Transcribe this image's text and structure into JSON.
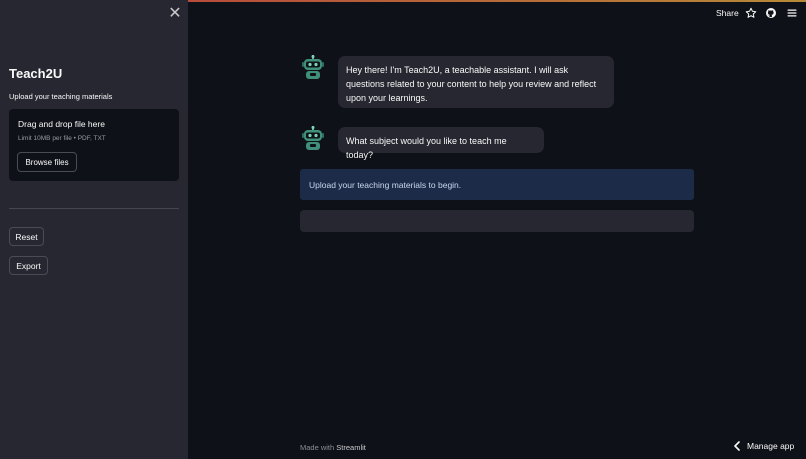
{
  "sidebar": {
    "close_icon": "close-icon",
    "title": "Teach2U",
    "upload_label": "Upload your teaching materials",
    "dropzone": {
      "title": "Drag and drop file here",
      "subtitle": "Limit 10MB per file • PDF, TXT",
      "browse_label": "Browse files"
    },
    "reset_label": "Reset",
    "export_label": "Export"
  },
  "header": {
    "share_label": "Share",
    "icons": [
      "star-icon",
      "github-icon",
      "menu-icon"
    ]
  },
  "chat": {
    "messages": [
      {
        "role": "assistant",
        "avatar": "robot-avatar-icon",
        "text": "Hey there! I'm Teach2U, a teachable assistant. I will ask questions related to your content to help you review and reflect upon your learnings."
      },
      {
        "role": "assistant",
        "avatar": "robot-avatar-icon",
        "text": "What subject would you like to teach me today?"
      }
    ],
    "info_text": "Upload your teaching materials to begin.",
    "input_placeholder": ""
  },
  "footer": {
    "made_with": "Made with",
    "brand": "Streamlit",
    "manage_label": "Manage app"
  },
  "colors": {
    "background": "#0e1117",
    "sidebar": "#262730",
    "info": "#1c2b48"
  }
}
